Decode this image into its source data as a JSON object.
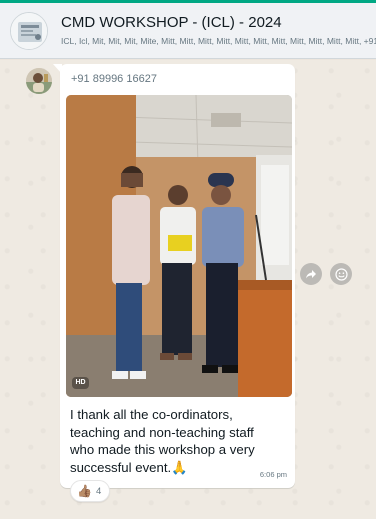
{
  "header": {
    "title": "CMD WORKSHOP - (ICL) - 2024",
    "members": "ICL, Icl, Mit, Mit, Mit, Mite, Mitt, Mitt, Mitt, Mitt, Mitt, Mitt, Mitt, Mitt, Mitt, Mitt, Mitt, +91"
  },
  "message": {
    "sender": "+91 89996 16627",
    "image_badge": "HD",
    "caption_lines": [
      "I thank all the co-ordinators,",
      "teaching and non-teaching staff",
      "who made this workshop a very",
      "successful  event.🙏"
    ],
    "time": "6:06 pm",
    "reaction": {
      "emoji": "👍🏽",
      "count": "4"
    }
  },
  "actions": {
    "forward_icon": "forward-icon",
    "emoji_icon": "emoji-icon"
  },
  "colors": {
    "accent": "#00a884",
    "chat_bg": "#efeae2",
    "bubble": "#ffffff"
  }
}
